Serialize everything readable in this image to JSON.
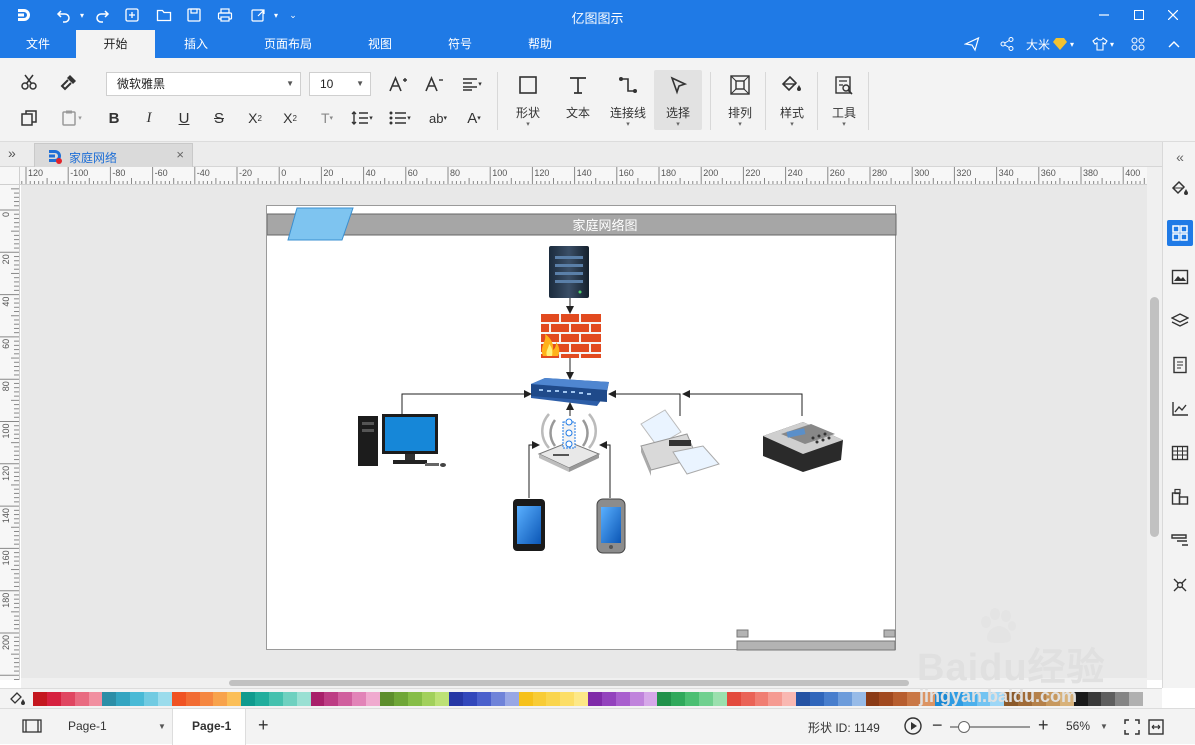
{
  "title": {
    "app_name": "亿图图示",
    "user_name": "大米"
  },
  "menu": {
    "tabs": [
      {
        "label": "文件"
      },
      {
        "label": "开始"
      },
      {
        "label": "插入"
      },
      {
        "label": "页面布局"
      },
      {
        "label": "视图"
      },
      {
        "label": "符号"
      },
      {
        "label": "帮助"
      }
    ]
  },
  "ribbon": {
    "font_family": "微软雅黑",
    "font_size": "10",
    "shape_label": "形状",
    "text_label": "文本",
    "connector_label": "连接线",
    "select_label": "选择",
    "arrange_label": "排列",
    "style_label": "样式",
    "tools_label": "工具"
  },
  "document": {
    "tab_title": "家庭网络"
  },
  "ruler": {
    "h_ticks": [
      "120",
      "-100",
      "-80",
      "-60",
      "-40",
      "-20",
      "0",
      "20",
      "40",
      "60",
      "80",
      "100",
      "120",
      "140",
      "160",
      "180",
      "200",
      "220",
      "240",
      "260",
      "280",
      "300",
      "320",
      "340",
      "360",
      "380",
      "400"
    ],
    "v_ticks": [
      "0",
      "20",
      "40",
      "60",
      "80",
      "100",
      "120",
      "140",
      "160",
      "180",
      "200"
    ]
  },
  "diagram": {
    "header_title": "家庭网络图"
  },
  "status": {
    "page_selector": "Page-1",
    "active_page": "Page-1",
    "shape_id_label": "形状 ID:",
    "shape_id": "1149",
    "zoom": "56%"
  },
  "watermark": {
    "brand": "Baidu经验",
    "url": "jingyan.baidu.com"
  },
  "colors": {
    "accent": "#1f7ae6",
    "header_bar": "#a6a6a6"
  },
  "palette": [
    "#c4171f",
    "#d6213f",
    "#e04661",
    "#e96b81",
    "#f18fa0",
    "#2c8ea7",
    "#34a5c1",
    "#49bad6",
    "#71cbe2",
    "#9bdcec",
    "#f05323",
    "#f26c33",
    "#f58741",
    "#f8a34c",
    "#fbbf58",
    "#0f9b8e",
    "#21ae9d",
    "#45c1ae",
    "#6fd1c0",
    "#9ae0d3",
    "#a8206a",
    "#bd3d84",
    "#d05f9e",
    "#e284b8",
    "#f0aacf",
    "#5d8e2c",
    "#6fa637",
    "#86bd47",
    "#a2d05c",
    "#bde176",
    "#2637a5",
    "#3247bb",
    "#4a60cc",
    "#6f83d9",
    "#98a7e5",
    "#f6c11b",
    "#f8cc36",
    "#fad54d",
    "#fcde67",
    "#fde887",
    "#7f2aa8",
    "#9342bd",
    "#a95fce",
    "#c083dc",
    "#d6a8e9",
    "#21924a",
    "#30a95b",
    "#4bbf72",
    "#70d08f",
    "#9be0ae",
    "#e34a3d",
    "#ea6357",
    "#f07e73",
    "#f59b92",
    "#f9b8b2",
    "#2553a4",
    "#3066bb",
    "#487ecd",
    "#6d9cdb",
    "#97bbe8",
    "#8a3a16",
    "#a1491f",
    "#b75e2f",
    "#ca7846",
    "#dc9463",
    "#1b89d4",
    "#2e9ce3",
    "#4cb0ec",
    "#73c4f2",
    "#9dd7f7",
    "#8b5a2b",
    "#a16c38",
    "#b5814a",
    "#c7995f",
    "#d8b27a",
    "#1a1a1a",
    "#3a3a3a",
    "#5e5e5e",
    "#858585",
    "#b0b0b0"
  ]
}
